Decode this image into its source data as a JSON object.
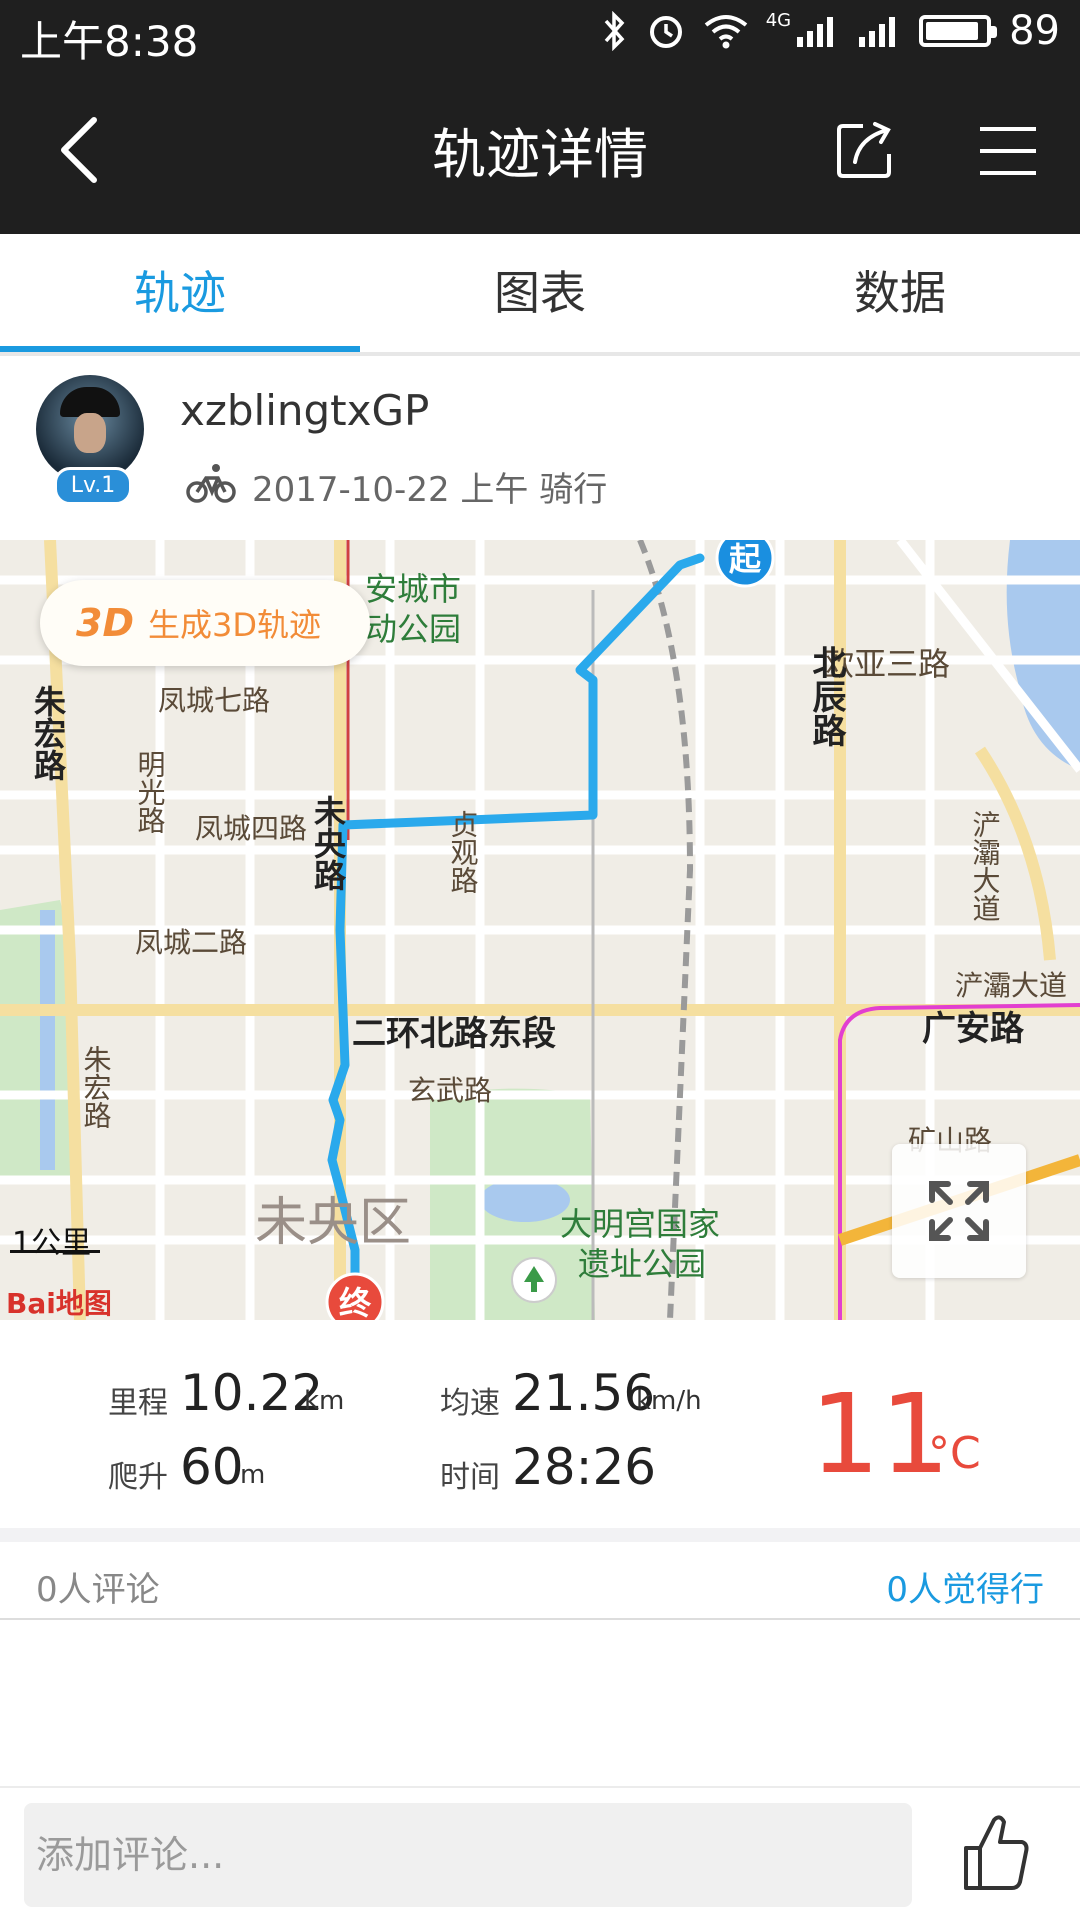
{
  "status_bar": {
    "time": "上午8:38",
    "network": "4G",
    "battery": "89",
    "battery_level": 0.89
  },
  "header": {
    "title": "轨迹详情",
    "icons": [
      "back-icon",
      "share-icon",
      "menu-icon"
    ]
  },
  "tabs": [
    {
      "label": "轨迹",
      "active": true
    },
    {
      "label": "图表",
      "active": false
    },
    {
      "label": "数据",
      "active": false
    }
  ],
  "user": {
    "name": "xzblingtxGP",
    "level": "Lv.1",
    "ride_info": "2017-10-22 上午 骑行",
    "activity_icon": "bicycle-icon"
  },
  "map": {
    "btn_3d_tag": "3D",
    "btn_3d_label": "生成3D轨迹",
    "scale": "1公里",
    "provider": "Bai地图",
    "start_marker": "起",
    "end_marker": "终",
    "labels": {
      "park1": "安城市",
      "park2": "动公园",
      "fengcheng7": "凤城七路",
      "fengcheng4": "凤城四路",
      "fengcheng2": "凤城二路",
      "zhuhong1": "朱宏路",
      "zhuhong2": "朱宏路",
      "mingguang": "明光路",
      "weiyang_road": "未央路",
      "zhenguan": "贞观路",
      "beichen": "北辰路",
      "ouya3": "欧亚三路",
      "erhuan": "二环北路东段",
      "xuanwu": "玄武路",
      "weiyang_district": "未央区",
      "daming1": "大明宫国家",
      "daming2": "遗址公园",
      "guangan": "广安路",
      "chanba": "浐灞大道",
      "chanba_road": "浐灞大道",
      "kuangshan": "矿山路"
    },
    "route_color": "#2aa9ec",
    "metro_color": "#e23fd0"
  },
  "stats": {
    "distance_label": "里程",
    "distance_value": "10.22",
    "distance_unit": "km",
    "speed_label": "均速",
    "speed_value": "21.56",
    "speed_unit": "km/h",
    "climb_label": "爬升",
    "climb_value": "60",
    "climb_unit": "m",
    "time_label": "时间",
    "time_value": "28:26",
    "temperature_value": "11",
    "temperature_unit": "°C"
  },
  "comments": {
    "count_text": "0人评论",
    "likes_text": "0人觉得行",
    "input_placeholder": "添加评论..."
  }
}
